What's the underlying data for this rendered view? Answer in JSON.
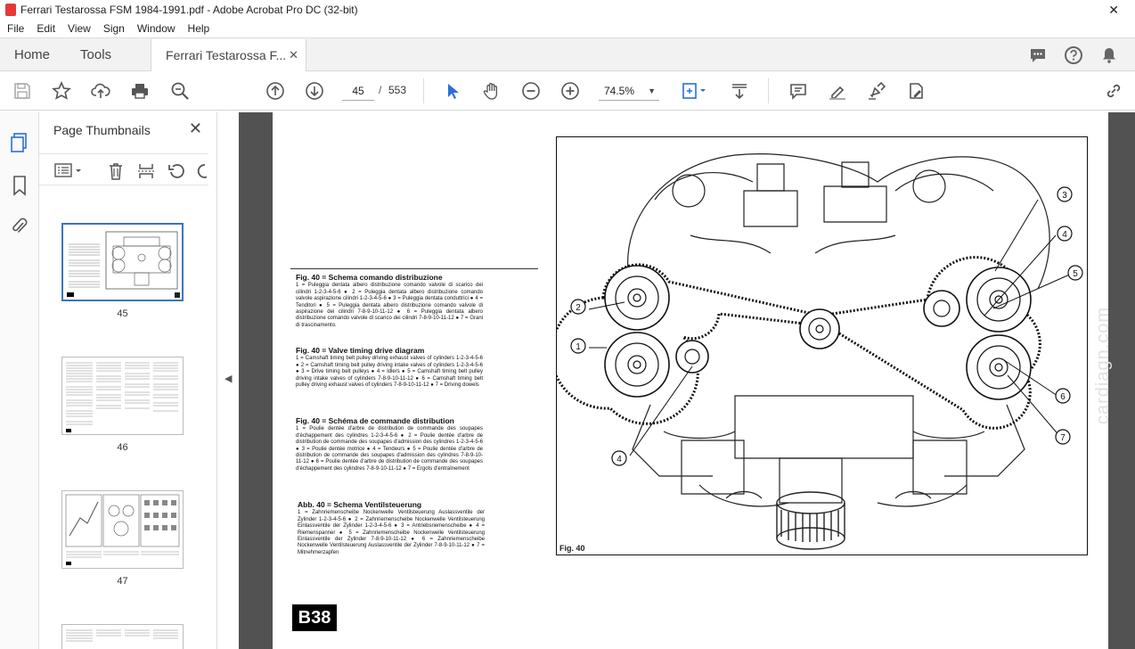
{
  "window": {
    "title": "Ferrari Testarossa FSM 1984-1991.pdf - Adobe Acrobat Pro DC (32-bit)",
    "close_glyph": "✕"
  },
  "menu": [
    "File",
    "Edit",
    "View",
    "Sign",
    "Window",
    "Help"
  ],
  "tabs": {
    "home": "Home",
    "tools": "Tools",
    "document": "Ferrari Testarossa F...",
    "close_glyph": "✕"
  },
  "toolbar": {
    "current_page": "45",
    "page_separator": "/",
    "total_pages": "553",
    "zoom": "74.5%"
  },
  "panel": {
    "title": "Page Thumbnails",
    "close_glyph": "✕"
  },
  "thumbnails": [
    {
      "label": "45",
      "selected": true
    },
    {
      "label": "46",
      "selected": false
    },
    {
      "label": "47",
      "selected": false
    }
  ],
  "page": {
    "captions": [
      {
        "title": "Fig. 40 = Schema comando distribuzione",
        "body": "1 = Puleggia dentata albero distribuzione comando valvole di scarico dei cilindri 1-2-3-4-5-6 ● 2 = Puleggia dentata albero distribuzione comando valvole aspirazione cilindri 1-2-3-4-5-6 ● 3 = Puleggia dentata conduttrici ● 4 = Tenditori ● 5 = Puleggia dentata albero distribuzione comando valvole di aspirazione dei cilindri 7-8-9-10-11-12 ● 6 = Puleggia dentata albero distribuzione comando valvole di scarico dei cilindri 7-8-9-10-11-12 ● 7 = Grani di trascinamento."
      },
      {
        "title": "Fig. 40 = Valve timing drive diagram",
        "body": "1 = Camshaft timing belt pulley driving exhaust valves of cylinders 1-2-3-4-5-6 ● 2 = Camshaft timing belt pulley driving intake valves of cylinders 1-2-3-4-5-6 ● 3 = Drive timing belt pulleys ● 4 = Idlers ● 5 = Camshaft timing belt pulley driving intake valves of cylinders 7-8-9-10-11-12 ● 6 = Camshaft timing belt pulley driving exhaust valves of cylinders 7-8-9-10-11-12 ● 7 = Driving dowels"
      },
      {
        "title": "Fig. 40 = Schéma de commande distribution",
        "body": "1 = Poulie dentée d'arbre de distribution de commande des soupapes d'échappement des cylindres 1-2-3-4-5-6 ● 2 = Poulie dentée d'arbre de distribution de commande des soupapes d'admission des cylindres 1-2-3-4-5-6 ● 3 = Poulie dentée motrice ● 4 = Tendeurs ● 5 = Poulie dentée d'arbre de distribution de commande des soupapes d'admission des cylindres 7-8-9-10-11-12 ● 6 = Poulie dentée d'arbre de distribution de commande des soupapes d'échappement des cylindres 7-8-9-10-11-12 ● 7 = Ergots d'entraînement"
      },
      {
        "title": "Abb. 40 = Schema Ventilsteuerung",
        "body": "1 = Zahnriemenscheibe Nockenwelle Ventilsteuerung Auslassventile der Zylinder 1-2-3-4-5-6 ● 2 = Zahnriemenscheibe Nockenwelle Ventilsteuerung Einlassventile der Zylinder 1-2-3-4-5-6 ● 3 = Antriebsriemenscheibe ● 4 = Riemenspanner ● 5 = Zahnriemenscheibe Nockenwelle Ventilsteuerung Einlassventile der Zylinder 7-8-9-10-11-12 ● 6 = Zahnriemenscheibe Nockenwelle Ventilsteuerung Auslassventile der Zylinder 7-8-9-10-11-12 ● 7 = Mitnehmerzapfen"
      }
    ],
    "figure_label": "Fig. 40",
    "callouts": [
      "1",
      "2",
      "3",
      "4",
      "4",
      "5",
      "6",
      "7"
    ],
    "page_badge": "B38",
    "watermark": "cardiagn.com"
  }
}
